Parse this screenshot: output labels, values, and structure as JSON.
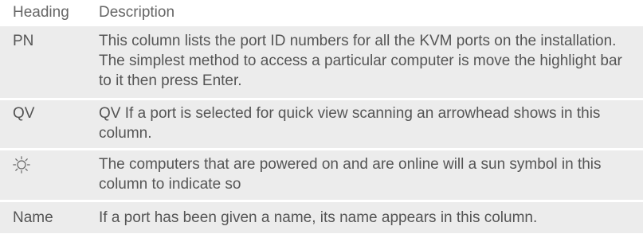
{
  "table": {
    "headers": {
      "heading": "Heading",
      "description": "Description"
    },
    "rows": [
      {
        "heading": "PN",
        "description": "This column lists the port ID numbers for all the KVM ports on the installation. The simplest method to access a particular computer is move the highlight bar to it then press Enter."
      },
      {
        "heading": "QV",
        "description": "QV If a port is selected for quick view scanning an arrowhead shows in this column."
      },
      {
        "heading_icon": "sun-icon",
        "description": "The computers that are powered on and are online will a sun symbol in this column to indicate so"
      },
      {
        "heading": "Name",
        "description": "If a port has been given a name, its name appears in this column."
      }
    ]
  },
  "colors": {
    "row_background": "#ececec",
    "text": "#555555"
  }
}
